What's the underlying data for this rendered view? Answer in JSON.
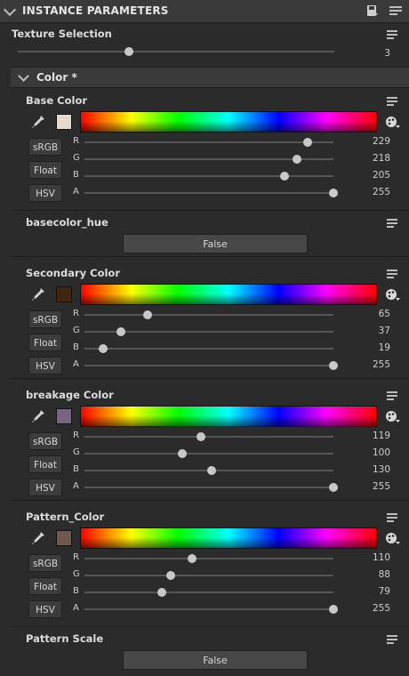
{
  "header": {
    "title": "INSTANCE PARAMETERS"
  },
  "texture_selection": {
    "label": "Texture Selection",
    "value": "3",
    "fraction": 0.35
  },
  "color_section": {
    "title": "Color *"
  },
  "color_groups": [
    {
      "label": "Base Color",
      "swatch": "#e5dacd",
      "buttons": [
        "sRGB",
        "Float",
        "HSV"
      ],
      "channels": [
        {
          "name": "R",
          "value": "229"
        },
        {
          "name": "G",
          "value": "218"
        },
        {
          "name": "B",
          "value": "205"
        },
        {
          "name": "A",
          "value": "255"
        }
      ]
    },
    {
      "label": "Secondary Color",
      "swatch": "#412513",
      "buttons": [
        "sRGB",
        "Float",
        "HSV"
      ],
      "channels": [
        {
          "name": "R",
          "value": "65"
        },
        {
          "name": "G",
          "value": "37"
        },
        {
          "name": "B",
          "value": "19"
        },
        {
          "name": "A",
          "value": "255"
        }
      ]
    },
    {
      "label": "breakage Color",
      "swatch": "#776482",
      "buttons": [
        "sRGB",
        "Float",
        "HSV"
      ],
      "channels": [
        {
          "name": "R",
          "value": "119"
        },
        {
          "name": "G",
          "value": "100"
        },
        {
          "name": "B",
          "value": "130"
        },
        {
          "name": "A",
          "value": "255"
        }
      ]
    },
    {
      "label": "Pattern_Color",
      "swatch": "#6e584f",
      "buttons": [
        "sRGB",
        "Float",
        "HSV"
      ],
      "channels": [
        {
          "name": "R",
          "value": "110"
        },
        {
          "name": "G",
          "value": "88"
        },
        {
          "name": "B",
          "value": "79"
        },
        {
          "name": "A",
          "value": "255"
        }
      ]
    }
  ],
  "basecolor_hue": {
    "label": "basecolor_hue",
    "value": "False"
  },
  "pattern_scale": {
    "label": "Pattern Scale",
    "value": "False"
  },
  "icons": {
    "pipette": "eyedropper-icon",
    "palette": "color-palette-icon",
    "menu": "options-menu-icon"
  }
}
